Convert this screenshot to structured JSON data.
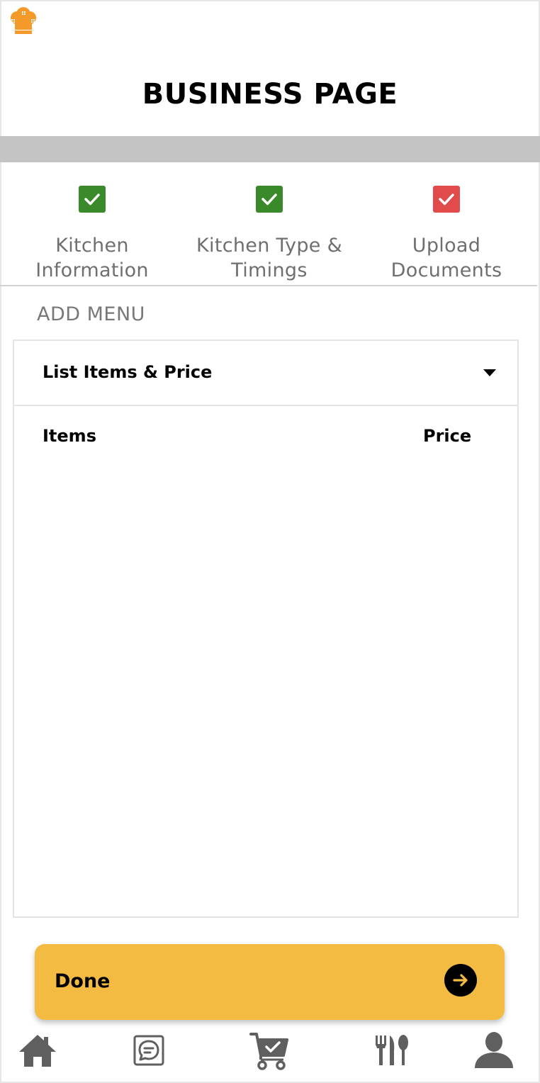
{
  "header": {
    "title": "BUSINESS PAGE",
    "logo_icon": "chef-hat-icon",
    "logo_color": "#f39a2b"
  },
  "steps": [
    {
      "label_line1": "Kitchen",
      "label_line2": "Information",
      "status": "complete",
      "color": "#3a8a2b"
    },
    {
      "label_line1": "Kitchen Type &",
      "label_line2": "Timings",
      "status": "complete",
      "color": "#3a8a2b"
    },
    {
      "label_line1": "Upload",
      "label_line2": "Documents",
      "status": "incomplete",
      "color": "#e24b4b"
    }
  ],
  "section": {
    "title": "ADD MENU"
  },
  "menu": {
    "dropdown_label": "List Items & Price",
    "columns": {
      "items": "Items",
      "price": "Price"
    },
    "rows": []
  },
  "done_button": {
    "label": "Done",
    "color": "#f3bb41",
    "icon": "arrow-right-icon"
  },
  "bottom_nav": [
    {
      "name": "home",
      "icon": "home-icon"
    },
    {
      "name": "messages",
      "icon": "chat-icon"
    },
    {
      "name": "orders",
      "icon": "cart-check-icon"
    },
    {
      "name": "menu",
      "icon": "fork-knife-icon"
    },
    {
      "name": "profile",
      "icon": "user-icon"
    }
  ],
  "nav_icon_color": "#5f5f5f"
}
